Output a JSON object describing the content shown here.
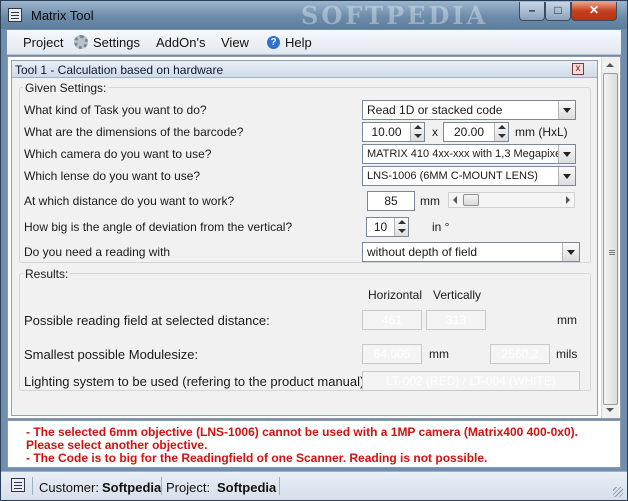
{
  "window": {
    "title": "Matrix Tool",
    "watermark": "SOFTPEDIA",
    "min": "–",
    "max": "□",
    "close": "✕"
  },
  "menu": {
    "project": "Project",
    "settings": "Settings",
    "addons": "AddOn's",
    "view": "View",
    "help": "Help"
  },
  "panel": {
    "title": "Tool 1 - Calculation based on hardware",
    "close": "x"
  },
  "given": {
    "legend": "Given Settings:",
    "task_label": "What kind of Task you want to do?",
    "task_value": "Read 1D or stacked code",
    "dims_label": "What are the dimensions of the barcode?",
    "dim_h": "10.00",
    "dim_x": "x",
    "dim_l": "20.00",
    "dim_unit": "mm (HxL)",
    "camera_label": "Which camera do you want to use?",
    "camera_value": "MATRIX 410 4xx-xxx with 1,3 Megapixel",
    "lense_label": "Which lense do you want to use?",
    "lense_value": "LNS-1006  (6MM C-MOUNT LENS)",
    "distance_label": "At which distance do you want to work?",
    "distance_value": "85",
    "distance_unit": "mm",
    "angle_label": "How big is the angle of deviation from the vertical?",
    "angle_value": "10",
    "angle_unit": "in °",
    "reading_label": "Do you need a reading with",
    "reading_value": "without depth of field"
  },
  "results": {
    "legend": "Results:",
    "col_h": "Horizontal",
    "col_v": "Vertically",
    "field_label": "Possible reading field at selected distance:",
    "field_h": "461",
    "field_v": "313",
    "field_unit": "mm",
    "module_label": "Smallest possible Modulesize:",
    "module_mm": "64.005",
    "module_mm_unit": "mm",
    "module_mils": "2560.2",
    "module_mils_unit": "mils",
    "light_label": "Lighting system to be used (refering to the product manual):",
    "light_value": "LT-002 (RED) / LT-004 (WHITE)"
  },
  "messages": [
    "- The selected 6mm objective (LNS-1006) cannot be used with a 1MP camera (Matrix400 400-0x0).",
    "Please select another objective.",
    "- The Code is to big for the Readingfield of one Scanner. Reading is not possible."
  ],
  "status": {
    "customer_label": "Customer:",
    "customer_value": "Softpedia",
    "project_label": "Project:",
    "project_value": "Softpedia"
  },
  "colors": {
    "error": "#d51010",
    "titlebar": "#6d8cab"
  }
}
